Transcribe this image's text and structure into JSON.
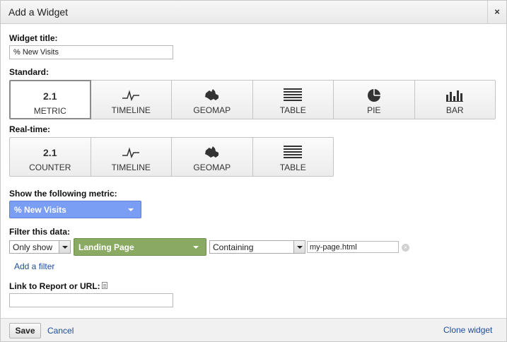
{
  "dialog": {
    "title": "Add a Widget",
    "close_glyph": "×"
  },
  "widget_title": {
    "label": "Widget title:",
    "value": "% New Visits"
  },
  "standard": {
    "label": "Standard:",
    "options": [
      {
        "glyph": "2.1",
        "icon": "metric-icon",
        "label": "METRIC",
        "selected": true
      },
      {
        "icon": "timeline-icon",
        "label": "TIMELINE"
      },
      {
        "icon": "geomap-icon",
        "label": "GEOMAP"
      },
      {
        "icon": "table-icon",
        "label": "TABLE"
      },
      {
        "icon": "pie-icon",
        "label": "PIE"
      },
      {
        "icon": "bar-icon",
        "label": "BAR"
      }
    ]
  },
  "realtime": {
    "label": "Real-time:",
    "options": [
      {
        "glyph": "2.1",
        "icon": "counter-icon",
        "label": "COUNTER"
      },
      {
        "icon": "timeline-icon",
        "label": "TIMELINE"
      },
      {
        "icon": "geomap-icon",
        "label": "GEOMAP"
      },
      {
        "icon": "table-icon",
        "label": "TABLE"
      }
    ]
  },
  "metric": {
    "label": "Show the following metric:",
    "value": "% New Visits",
    "color": "#7b9ef5"
  },
  "filter": {
    "label": "Filter this data:",
    "mode": "Only show",
    "dimension": "Landing Page",
    "dimension_color": "#8aaa63",
    "match": "Containing",
    "value": "my-page.html",
    "add_filter": "Add a filter"
  },
  "link": {
    "label": "Link to Report or URL:",
    "value": ""
  },
  "footer": {
    "save": "Save",
    "cancel": "Cancel",
    "clone": "Clone widget"
  }
}
